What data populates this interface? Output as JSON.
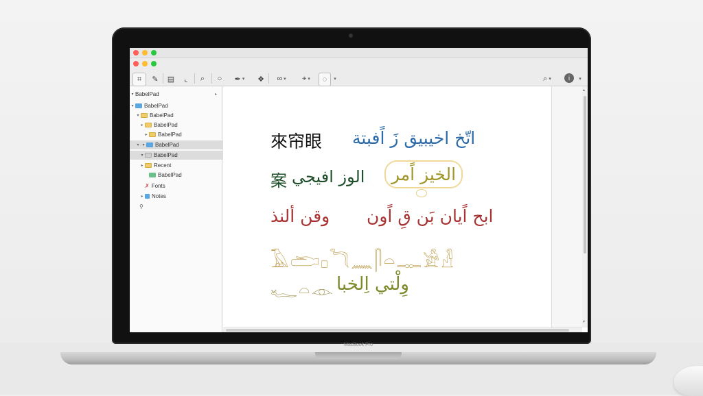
{
  "window": {
    "traffic_lights": {
      "close": "#ff5f57",
      "minimize": "#febc2e",
      "zoom": "#28c840"
    }
  },
  "toolbar": {
    "icons": [
      "pen-tool-icon",
      "brush-icon",
      "text-frame-icon",
      "crop-icon",
      "search-icon",
      "zoom-icon",
      "draw-icon",
      "stamp-icon",
      "link-icon",
      "tag-icon",
      "shape-icon",
      "search-icon",
      "info-icon"
    ]
  },
  "sidebar": {
    "header": "BabelPad",
    "items": [
      {
        "label": "BabelPad",
        "icon": "folder-blue"
      },
      {
        "label": "BabelPad",
        "icon": "folder-yellow"
      },
      {
        "label": "BabelPad",
        "icon": "folder-yellow"
      },
      {
        "label": "BabelPad",
        "icon": "folder-yellow"
      },
      {
        "label": "BabelPad",
        "icon": "folder-blue",
        "selected": true
      },
      {
        "label": "BabelPad",
        "icon": "folder-gray",
        "selected": true
      },
      {
        "label": "Recent",
        "icon": "folder-yellow"
      },
      {
        "label": "BabelPad",
        "icon": "folder-green"
      },
      {
        "label": "Fonts",
        "icon": "fonts-icon"
      },
      {
        "label": "Notes",
        "icon": "folder-blue"
      }
    ]
  },
  "document": {
    "line1_cjk": "來帘眼",
    "line1_arabic": "اتّخ اخيبيق زَ اًفبتة",
    "line2_cjk": "案",
    "line2_arabic": "الوز افيجي",
    "line2_highlight": "الخيز اًمر",
    "line3_left": "وقن ألنذ",
    "line3_right": "ابح اًيان بَن قِ اًون",
    "line4_glyphs": "𓄿𓂧𓊪𓆓𓈖𓋴𓏏𓊃𓀀𓁐",
    "line5_glyphs": "𓆑𓏏𓁹",
    "line5_arabic": "وِلْتي اِلخبا"
  },
  "colors": {
    "accent_blue": "#2c6aa8",
    "accent_red": "#a83232",
    "accent_gold": "#b08a2c",
    "accent_green": "#1f4f2a"
  },
  "laptop": {
    "brand": "MacBook Pro"
  }
}
